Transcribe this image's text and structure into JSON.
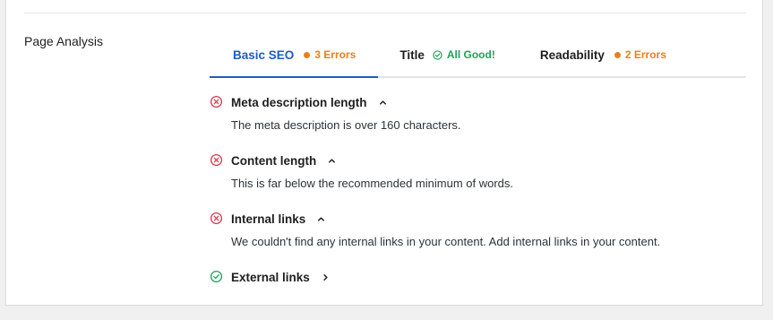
{
  "section": {
    "label": "Page Analysis"
  },
  "tabs": [
    {
      "label": "Basic SEO",
      "status": "3 Errors",
      "status_type": "error",
      "active": true
    },
    {
      "label": "Title",
      "status": "All Good!",
      "status_type": "good",
      "active": false
    },
    {
      "label": "Readability",
      "status": "2 Errors",
      "status_type": "error",
      "active": false
    }
  ],
  "results": [
    {
      "title": "Meta description length",
      "status": "error",
      "expanded": true,
      "description": "The meta description is over 160 characters."
    },
    {
      "title": "Content length",
      "status": "error",
      "expanded": true,
      "description": "This is far below the recommended minimum of words."
    },
    {
      "title": "Internal links",
      "status": "error",
      "expanded": true,
      "description": "We couldn't find any internal links in your content. Add internal links in your content."
    },
    {
      "title": "External links",
      "status": "good",
      "expanded": false,
      "description": ""
    }
  ],
  "colors": {
    "accent": "#1e5cc2",
    "error": "#d63b4f",
    "good": "#22a05a",
    "warning": "#e8801a"
  },
  "icons": {
    "error": "x-circle-icon",
    "good": "check-circle-icon",
    "expanded": "chevron-up-icon",
    "collapsed": "chevron-right-icon"
  }
}
